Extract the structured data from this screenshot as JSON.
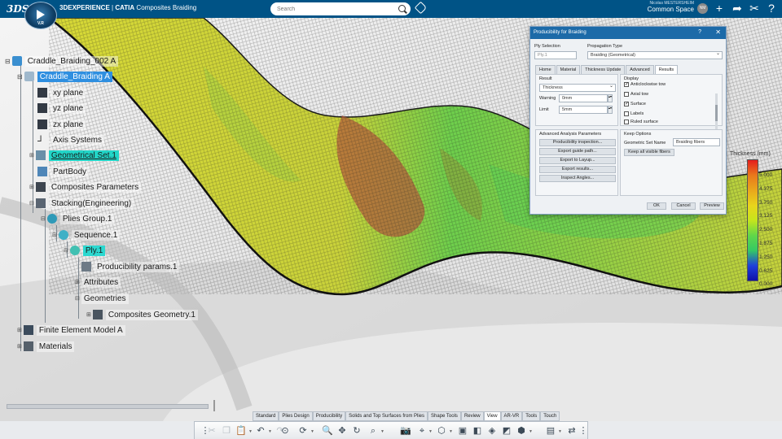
{
  "topbar": {
    "logo": "3DS",
    "compass_version": "V.R",
    "app_brand": "3DEXPERIENCE",
    "app_separator": " | ",
    "app_name": "CATIA",
    "app_module": "Composites Braiding",
    "search_placeholder": "Search",
    "user_name": "Nicolas MESTERSHEIM",
    "space": "Common Space",
    "avatar_initials": "NM",
    "icons": [
      "add-icon",
      "share-icon",
      "tools-icon",
      "help-icon"
    ]
  },
  "tree": {
    "items": [
      {
        "label": "Craddle_Braiding_002 A",
        "icon": "product-icon"
      },
      {
        "label": "Craddle_Braiding A",
        "icon": "part-icon",
        "selected": "blue"
      },
      {
        "label": "xy plane",
        "icon": "plane-icon"
      },
      {
        "label": "yz plane",
        "icon": "plane-icon"
      },
      {
        "label": "zx plane",
        "icon": "plane-icon"
      },
      {
        "label": "Axis Systems",
        "icon": "axis-icon"
      },
      {
        "label": "Geometrical Set.1",
        "icon": "geoset-icon",
        "selected": "teal"
      },
      {
        "label": "PartBody",
        "icon": "body-icon"
      },
      {
        "label": "Composites Parameters",
        "icon": "params-icon"
      },
      {
        "label": "Stacking(Engineering)",
        "icon": "stacking-icon"
      },
      {
        "label": "Plies Group.1",
        "icon": "plies-group-icon"
      },
      {
        "label": "Sequence.1",
        "icon": "sequence-icon"
      },
      {
        "label": "Ply.1",
        "icon": "ply-icon",
        "selected": "cyan"
      },
      {
        "label": "Producibility params.1",
        "icon": "producibility-icon"
      },
      {
        "label": "Attributes",
        "icon": "none"
      },
      {
        "label": "Geometries",
        "icon": "none"
      },
      {
        "label": "Composites Geometry.1",
        "icon": "composites-geometry-icon"
      },
      {
        "label": "Finite Element Model A",
        "icon": "fem-icon"
      },
      {
        "label": "Materials",
        "icon": "materials-icon"
      }
    ]
  },
  "dialog": {
    "title": "Producibility for Braiding",
    "help": "?",
    "close": "✕",
    "ply_selection_label": "Ply Selection",
    "ply_selection_value": "Ply.1",
    "propagation_label": "Propagation Type",
    "propagation_value": "Braiding (Geometrical)",
    "tabs": [
      "Home",
      "Material",
      "Thickness Update",
      "Advanced",
      "Results"
    ],
    "result_label": "Result",
    "result_value": "Thickness",
    "warning_label": "Warning",
    "warning_value": "0mm",
    "limit_label": "Limit",
    "limit_value": "5mm",
    "display_label": "Display",
    "display_options": [
      {
        "label": "Anticlockwise tow",
        "checked": true
      },
      {
        "label": "Axial tow",
        "checked": false
      },
      {
        "label": "Surface",
        "checked": true
      },
      {
        "label": "Labels",
        "checked": false
      },
      {
        "label": "Ruled surface",
        "checked": false
      }
    ],
    "advanced_label": "Advanced Analysis Parameters",
    "advanced_buttons": [
      "Producibility inspection...",
      "Export guide path...",
      "Export to Layup...",
      "Export results...",
      "Inspect Angles..."
    ],
    "keep_label": "Keep Options",
    "geoset_name_label": "Geometric Set Name",
    "geoset_name_value": "Braiding fibers",
    "keep_button": "Keep all visible fibers",
    "ok": "OK",
    "cancel": "Cancel",
    "preview": "Preview"
  },
  "color_scale": {
    "title": "Thickness (mm)",
    "labels": [
      "5.000",
      "4.375",
      "3.750",
      "3.125",
      "2.500",
      "1.875",
      "1.250",
      "0.625",
      "0.000"
    ],
    "colors": [
      "#e41d1d",
      "#e97a1c",
      "#e9a71c",
      "#e8d51c",
      "#c6e51c",
      "#5fd64a",
      "#35c964",
      "#1e3fdc",
      "#1010a8"
    ]
  },
  "bottom_tabs": [
    "Standard",
    "Plies Design",
    "Producibility",
    "Solids and Top Surfaces from Plies",
    "Shape Tools",
    "Review",
    "View",
    "AR-VR",
    "Tools",
    "Touch"
  ],
  "active_bottom_tab": "View",
  "toolbar_icons": [
    "cut-icon",
    "copy-icon",
    "paste-icon",
    "undo-icon",
    "redo-icon",
    "zoom-fit-icon",
    "rotate-icon",
    "zoom-icon",
    "pan-icon",
    "rotate-view-icon",
    "zoom-area-icon",
    "camera-icon",
    "normal-view-icon",
    "view-mode-icon",
    "iso-view-icon",
    "hide-icon",
    "render-icon",
    "shading-icon",
    "perspective-icon",
    "ambiance-icon",
    "swap-icon"
  ]
}
